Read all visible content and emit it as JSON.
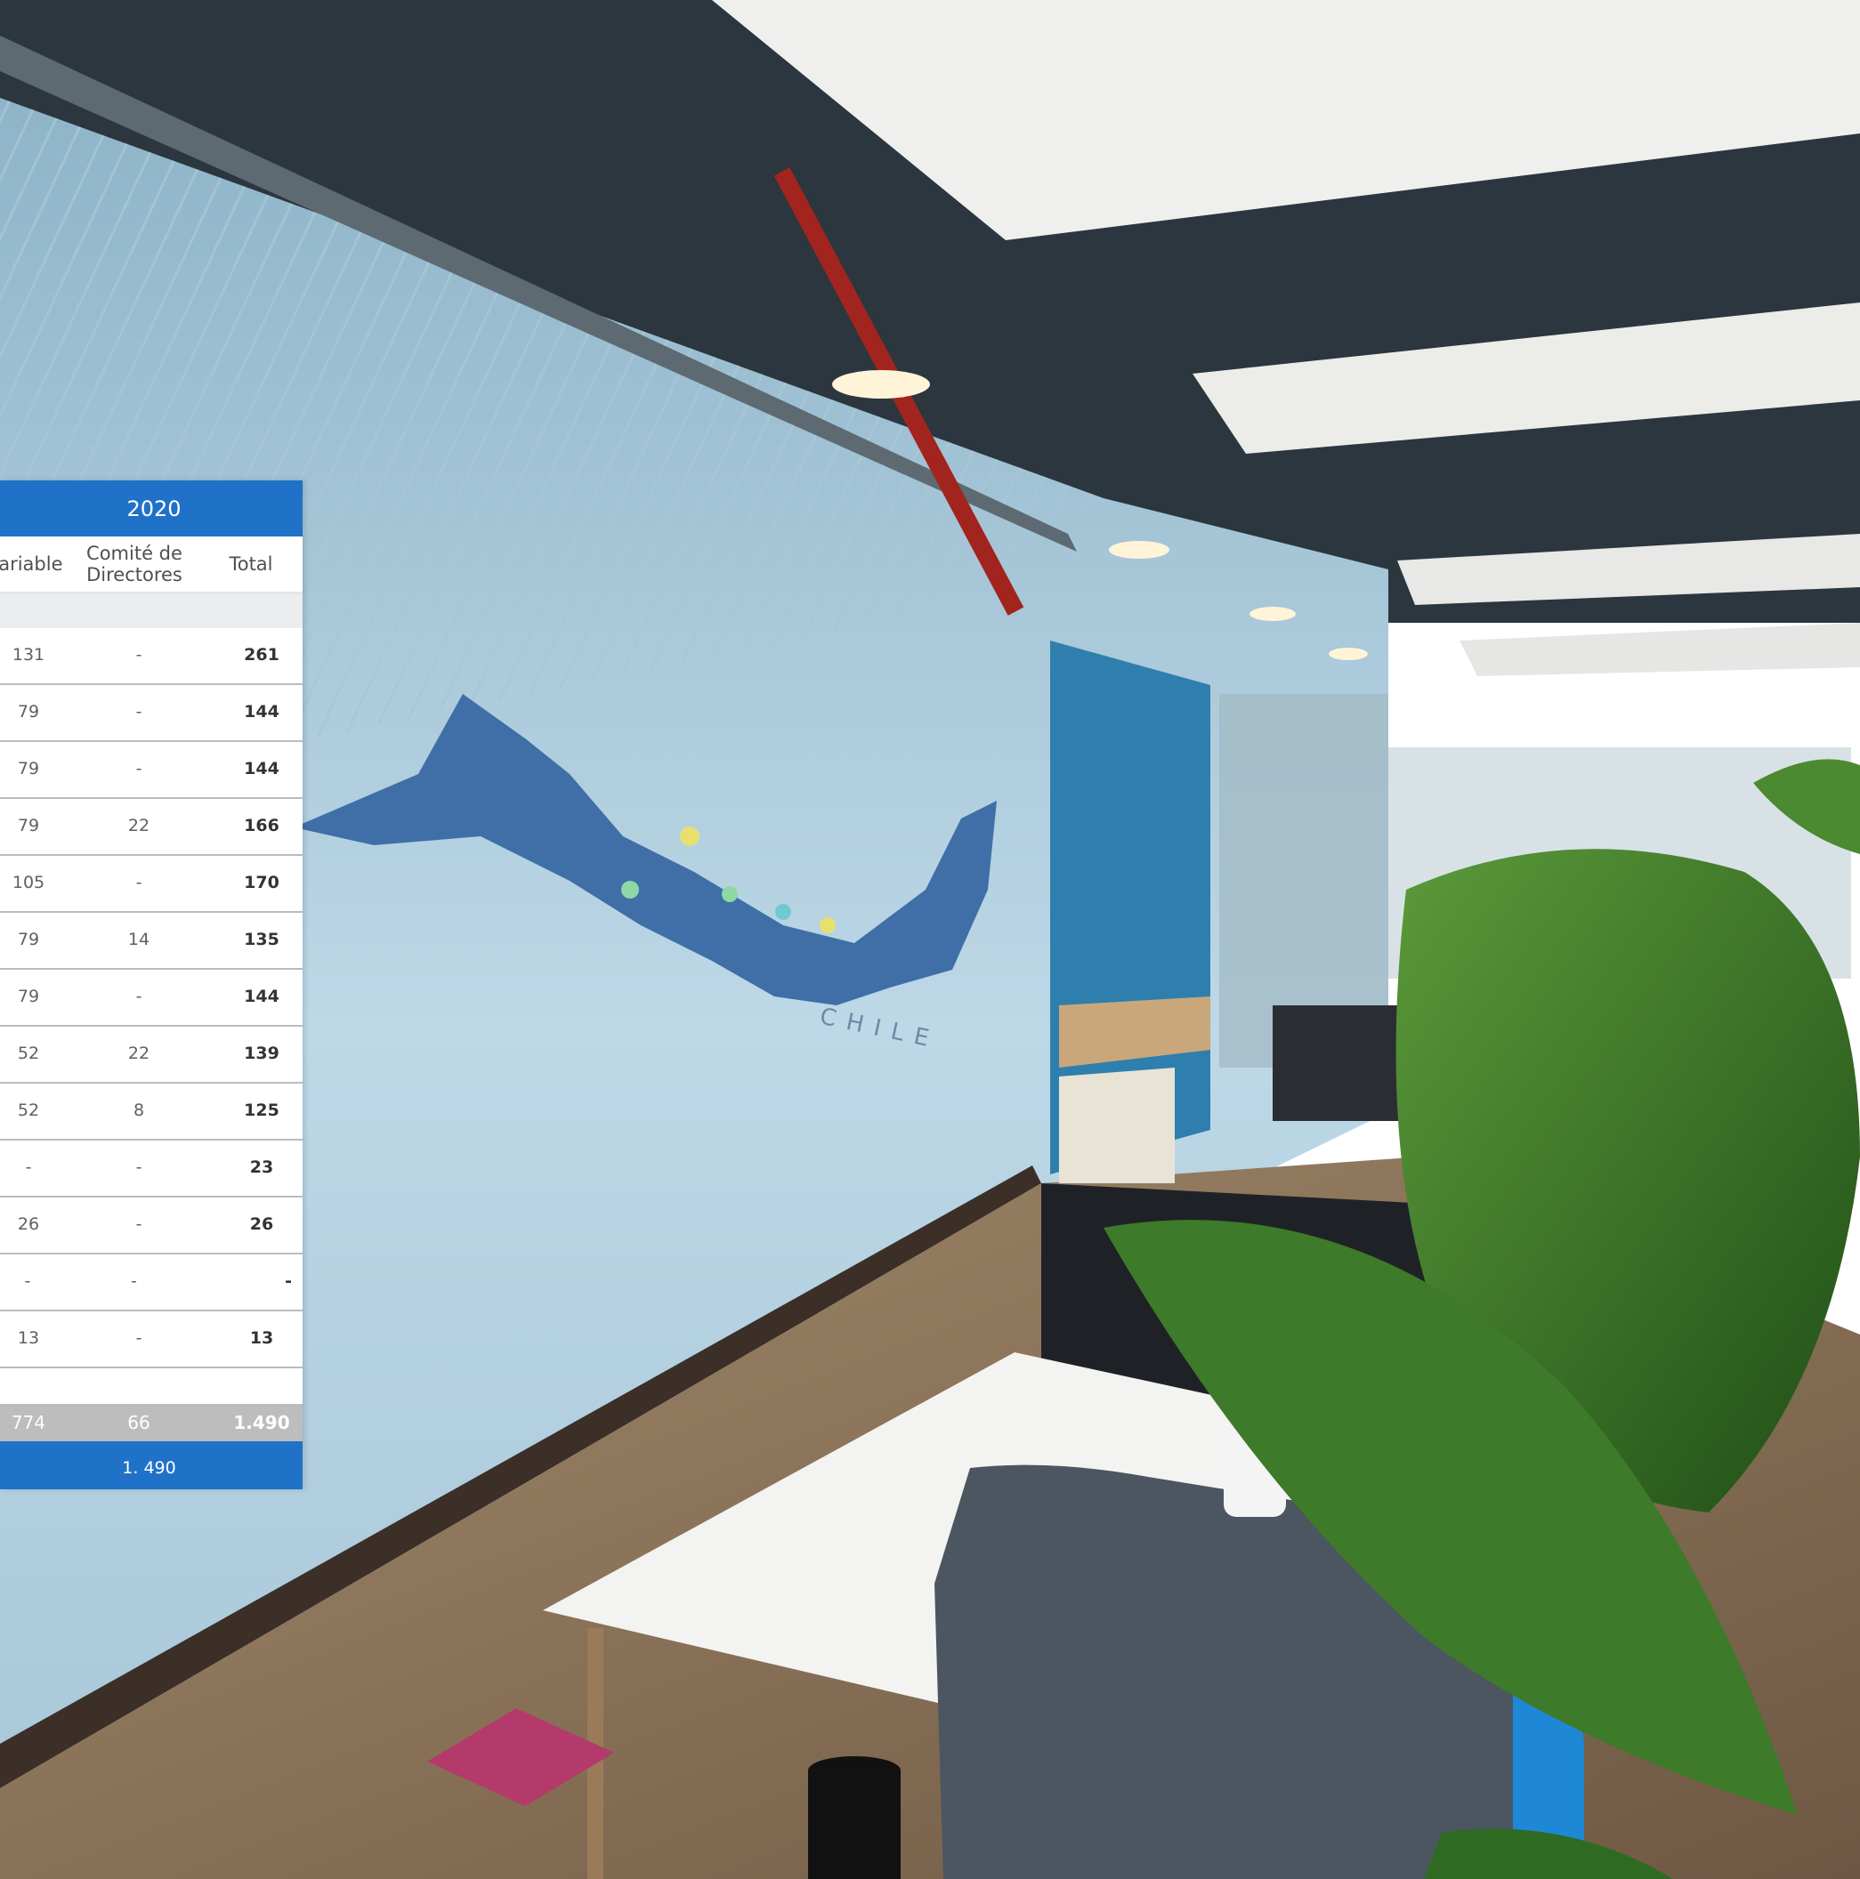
{
  "table": {
    "year": "2020",
    "columns": [
      "Variable",
      "Comité de Directores",
      "Total"
    ],
    "rows": [
      {
        "variable": "131",
        "comite": "-",
        "total": "261"
      },
      {
        "variable": "79",
        "comite": "-",
        "total": "144"
      },
      {
        "variable": "79",
        "comite": "-",
        "total": "144"
      },
      {
        "variable": "79",
        "comite": "22",
        "total": "166"
      },
      {
        "variable": "105",
        "comite": "-",
        "total": "170"
      },
      {
        "variable": "79",
        "comite": "14",
        "total": "135"
      },
      {
        "variable": "79",
        "comite": "-",
        "total": "144"
      },
      {
        "variable": "52",
        "comite": "22",
        "total": "139"
      },
      {
        "variable": "52",
        "comite": "8",
        "total": "125"
      },
      {
        "variable": "-",
        "comite": "-",
        "total": "23"
      },
      {
        "variable": "26",
        "comite": "-",
        "total": "26"
      },
      {
        "variable": "-",
        "comite": "-",
        "total": "-"
      },
      {
        "variable": "13",
        "comite": "-",
        "total": "13"
      }
    ],
    "totals": {
      "variable": "774",
      "comite": "66",
      "total": "1.490"
    },
    "grand_total": "1. 490"
  },
  "photo": {
    "wall_map_label": "CHILE",
    "colors": {
      "wall": "#b9d6e6",
      "ceiling": "#2e3a42",
      "panel": "#f0f0ee",
      "floor": "#8a7256",
      "booth": "#2f7fae",
      "map": "#3f6fa6",
      "leaf": "#2f6a22",
      "desk": "#f2f2f0",
      "chair": "#4b5660"
    }
  }
}
